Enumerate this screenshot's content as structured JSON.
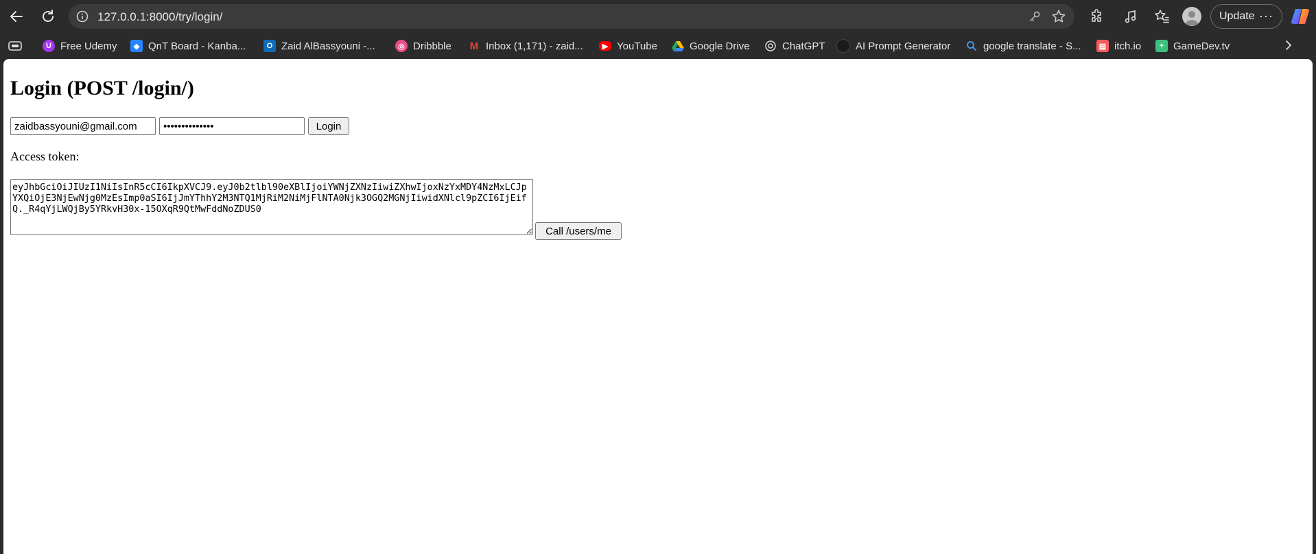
{
  "browser": {
    "url": "127.0.0.1:8000/try/login/",
    "update_label": "Update",
    "more_label": "···"
  },
  "bookmarks": [
    {
      "label": "Free Udemy",
      "icon": "udemy-icon",
      "color": "#a435f0"
    },
    {
      "label": "QnT Board - Kanba...",
      "icon": "jira-icon",
      "color": "#2684ff"
    },
    {
      "label": "Zaid AlBassyouni -...",
      "icon": "outlook-icon",
      "color": "#0f6cbd"
    },
    {
      "label": "Dribbble",
      "icon": "dribbble-icon",
      "color": "#ea4c89"
    },
    {
      "label": "Inbox (1,171) - zaid...",
      "icon": "gmail-icon",
      "color": "#ea4335"
    },
    {
      "label": "YouTube",
      "icon": "youtube-icon",
      "color": "#ff0000"
    },
    {
      "label": "Google Drive",
      "icon": "google-drive-icon",
      "color": "#1fa463"
    },
    {
      "label": "ChatGPT",
      "icon": "chatgpt-icon",
      "color": "#d9d9d9"
    },
    {
      "label": "AI Prompt Generator",
      "icon": "ai-prompt-icon",
      "color": "#1a1a1a"
    },
    {
      "label": "google translate - S...",
      "icon": "search-icon",
      "color": "#4a90e2"
    },
    {
      "label": "itch.io",
      "icon": "itchio-icon",
      "color": "#fa5c5c"
    },
    {
      "label": "GameDev.tv",
      "icon": "gamedev-icon",
      "color": "#3fbf7f"
    }
  ],
  "page": {
    "title": "Login (POST /login/)",
    "email_value": "zaidbassyouni@gmail.com",
    "password_value": "••••••••••••••",
    "login_button": "Login",
    "token_label": "Access token:",
    "token_value": "eyJhbGciOiJIUzI1NiIsInR5cCI6IkpXVCJ9.eyJ0b2tlbl90eXBlIjoiYWNjZXNzIiwiZXhwIjoxNzYxMDY4NzMxLCJpYXQiOjE3NjEwNjg0MzEsImp0aSI6IjJmYThhY2M3NTQ1MjRiM2NiMjFlNTA0Njk3OGQ2MGNjIiwidXNlcl9pZCI6IjEifQ._R4qYjLWQjBy5YRkvH30x-15OXqR9QtMwFddNoZDUS0",
    "call_button": "Call /users/me"
  }
}
